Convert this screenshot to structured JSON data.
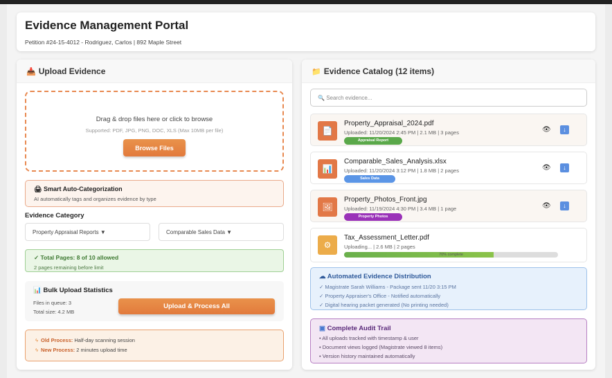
{
  "header": {
    "title": "Evidence Management Portal",
    "subtitle": "Petition #24-15-4012 - Rodriguez, Carlos | 892 Maple Street"
  },
  "upload": {
    "title": "Upload Evidence",
    "drop_text": "Drag & drop files here or click to browse",
    "supported": "Supported: PDF, JPG, PNG, DOC, XLS (Max 10MB per file)",
    "browse": "Browse Files",
    "auto_title": "Smart Auto-Categorization",
    "auto_desc": "AI automatically tags and organizes evidence by type",
    "category_label": "Evidence Category",
    "select1": "Property Appraisal Reports ▼",
    "select2": "Comparable Sales Data ▼",
    "pages_title": "✓ Total Pages: 8 of 10 allowed",
    "pages_desc": "2 pages remaining before limit",
    "bulk_title": "Bulk Upload Statistics",
    "files_queue": "Files in queue: 3",
    "total_size": "Total size: 4.2 MB",
    "upload_all": "Upload & Process All",
    "old_label": "Old Process:",
    "old_value": "Half-day scanning session",
    "new_label": "New Process:",
    "new_value": "2 minutes upload time"
  },
  "catalog": {
    "title": "Evidence Catalog (12 items)",
    "search_placeholder": "Search evidence...",
    "items": [
      {
        "name": "Property_Appraisal_2024.pdf",
        "meta": "Uploaded: 11/20/2024 2:45 PM | 2.1 MB | 3 pages",
        "tag": "Appraisal Report",
        "tag_color": "#5aa84a"
      },
      {
        "name": "Comparable_Sales_Analysis.xlsx",
        "meta": "Uploaded: 11/20/2024 3:12 PM | 1.8 MB | 2 pages",
        "tag": "Sales Data",
        "tag_color": "#5b95e6"
      },
      {
        "name": "Property_Photos_Front.jpg",
        "meta": "Uploaded: 11/19/2024 4:30 PM | 3.4 MB | 1 page",
        "tag": "Property Photos",
        "tag_color": "#9a32b8"
      },
      {
        "name": "Tax_Assessment_Letter.pdf",
        "meta": "Uploading... | 2.6 MB | 2 pages",
        "progress": 70,
        "progress_label": "70% complete"
      }
    ],
    "dist_title": "Automated Evidence Distribution",
    "dist": [
      "✓ Magistrate Sarah Williams - Package sent 11/20 3:15 PM",
      "✓ Property Appraiser's Office - Notified automatically",
      "✓ Digital hearing packet generated (No printing needed)"
    ],
    "audit_title": "Complete Audit Trail",
    "audit": [
      "• All uploads tracked with timestamp & user",
      "• Document views logged (Magistrate viewed 8 items)",
      "• Version history maintained automatically"
    ]
  }
}
